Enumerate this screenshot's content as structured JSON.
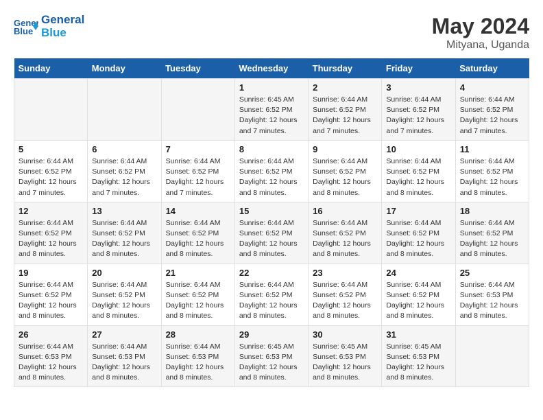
{
  "logo": {
    "line1": "General",
    "line2": "Blue"
  },
  "title": "May 2024",
  "subtitle": "Mityana, Uganda",
  "days_of_week": [
    "Sunday",
    "Monday",
    "Tuesday",
    "Wednesday",
    "Thursday",
    "Friday",
    "Saturday"
  ],
  "weeks": [
    {
      "days": [
        {
          "num": "",
          "info": ""
        },
        {
          "num": "",
          "info": ""
        },
        {
          "num": "",
          "info": ""
        },
        {
          "num": "1",
          "info": "Sunrise: 6:45 AM\nSunset: 6:52 PM\nDaylight: 12 hours and 7 minutes."
        },
        {
          "num": "2",
          "info": "Sunrise: 6:44 AM\nSunset: 6:52 PM\nDaylight: 12 hours and 7 minutes."
        },
        {
          "num": "3",
          "info": "Sunrise: 6:44 AM\nSunset: 6:52 PM\nDaylight: 12 hours and 7 minutes."
        },
        {
          "num": "4",
          "info": "Sunrise: 6:44 AM\nSunset: 6:52 PM\nDaylight: 12 hours and 7 minutes."
        }
      ]
    },
    {
      "days": [
        {
          "num": "5",
          "info": "Sunrise: 6:44 AM\nSunset: 6:52 PM\nDaylight: 12 hours and 7 minutes."
        },
        {
          "num": "6",
          "info": "Sunrise: 6:44 AM\nSunset: 6:52 PM\nDaylight: 12 hours and 7 minutes."
        },
        {
          "num": "7",
          "info": "Sunrise: 6:44 AM\nSunset: 6:52 PM\nDaylight: 12 hours and 7 minutes."
        },
        {
          "num": "8",
          "info": "Sunrise: 6:44 AM\nSunset: 6:52 PM\nDaylight: 12 hours and 8 minutes."
        },
        {
          "num": "9",
          "info": "Sunrise: 6:44 AM\nSunset: 6:52 PM\nDaylight: 12 hours and 8 minutes."
        },
        {
          "num": "10",
          "info": "Sunrise: 6:44 AM\nSunset: 6:52 PM\nDaylight: 12 hours and 8 minutes."
        },
        {
          "num": "11",
          "info": "Sunrise: 6:44 AM\nSunset: 6:52 PM\nDaylight: 12 hours and 8 minutes."
        }
      ]
    },
    {
      "days": [
        {
          "num": "12",
          "info": "Sunrise: 6:44 AM\nSunset: 6:52 PM\nDaylight: 12 hours and 8 minutes."
        },
        {
          "num": "13",
          "info": "Sunrise: 6:44 AM\nSunset: 6:52 PM\nDaylight: 12 hours and 8 minutes."
        },
        {
          "num": "14",
          "info": "Sunrise: 6:44 AM\nSunset: 6:52 PM\nDaylight: 12 hours and 8 minutes."
        },
        {
          "num": "15",
          "info": "Sunrise: 6:44 AM\nSunset: 6:52 PM\nDaylight: 12 hours and 8 minutes."
        },
        {
          "num": "16",
          "info": "Sunrise: 6:44 AM\nSunset: 6:52 PM\nDaylight: 12 hours and 8 minutes."
        },
        {
          "num": "17",
          "info": "Sunrise: 6:44 AM\nSunset: 6:52 PM\nDaylight: 12 hours and 8 minutes."
        },
        {
          "num": "18",
          "info": "Sunrise: 6:44 AM\nSunset: 6:52 PM\nDaylight: 12 hours and 8 minutes."
        }
      ]
    },
    {
      "days": [
        {
          "num": "19",
          "info": "Sunrise: 6:44 AM\nSunset: 6:52 PM\nDaylight: 12 hours and 8 minutes."
        },
        {
          "num": "20",
          "info": "Sunrise: 6:44 AM\nSunset: 6:52 PM\nDaylight: 12 hours and 8 minutes."
        },
        {
          "num": "21",
          "info": "Sunrise: 6:44 AM\nSunset: 6:52 PM\nDaylight: 12 hours and 8 minutes."
        },
        {
          "num": "22",
          "info": "Sunrise: 6:44 AM\nSunset: 6:52 PM\nDaylight: 12 hours and 8 minutes."
        },
        {
          "num": "23",
          "info": "Sunrise: 6:44 AM\nSunset: 6:52 PM\nDaylight: 12 hours and 8 minutes."
        },
        {
          "num": "24",
          "info": "Sunrise: 6:44 AM\nSunset: 6:52 PM\nDaylight: 12 hours and 8 minutes."
        },
        {
          "num": "25",
          "info": "Sunrise: 6:44 AM\nSunset: 6:53 PM\nDaylight: 12 hours and 8 minutes."
        }
      ]
    },
    {
      "days": [
        {
          "num": "26",
          "info": "Sunrise: 6:44 AM\nSunset: 6:53 PM\nDaylight: 12 hours and 8 minutes."
        },
        {
          "num": "27",
          "info": "Sunrise: 6:44 AM\nSunset: 6:53 PM\nDaylight: 12 hours and 8 minutes."
        },
        {
          "num": "28",
          "info": "Sunrise: 6:44 AM\nSunset: 6:53 PM\nDaylight: 12 hours and 8 minutes."
        },
        {
          "num": "29",
          "info": "Sunrise: 6:45 AM\nSunset: 6:53 PM\nDaylight: 12 hours and 8 minutes."
        },
        {
          "num": "30",
          "info": "Sunrise: 6:45 AM\nSunset: 6:53 PM\nDaylight: 12 hours and 8 minutes."
        },
        {
          "num": "31",
          "info": "Sunrise: 6:45 AM\nSunset: 6:53 PM\nDaylight: 12 hours and 8 minutes."
        },
        {
          "num": "",
          "info": ""
        }
      ]
    }
  ]
}
